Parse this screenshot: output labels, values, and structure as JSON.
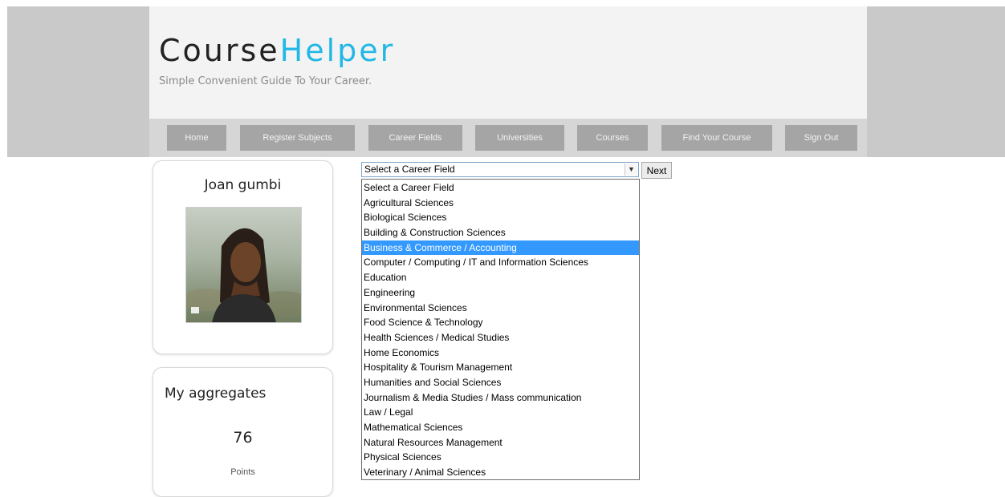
{
  "header": {
    "logo_part1": "Course",
    "logo_part2": "Helper",
    "tagline": "Simple Convenient Guide To Your Career."
  },
  "nav": {
    "items": [
      "Home",
      "Register Subjects",
      "Career Fields",
      "Universities",
      "Courses",
      "Find Your Course",
      "Sign Out"
    ]
  },
  "profile": {
    "name": "Joan gumbi"
  },
  "aggregates": {
    "title": "My aggregates",
    "value": "76",
    "unit": "Points"
  },
  "career_select": {
    "selected_label": "Select a Career Field",
    "next_label": "Next",
    "highlighted_option": "Business & Commerce / Accounting",
    "options": [
      "Select a Career Field",
      "Agricultural Sciences",
      "Biological Sciences",
      "Building & Construction Sciences",
      "Business & Commerce / Accounting",
      "Computer / Computing / IT and Information Sciences",
      "Education",
      "Engineering",
      "Environmental Sciences",
      "Food Science & Technology",
      "Health Sciences / Medical Studies",
      "Home Economics",
      "Hospitality & Tourism Management",
      "Humanities and Social Sciences",
      "Journalism & Media Studies / Mass communication",
      "Law / Legal",
      "Mathematical Sciences",
      "Natural Resources Management",
      "Physical Sciences",
      "Veterinary / Animal Sciences"
    ]
  },
  "colors": {
    "accent": "#22b8e6",
    "nav_button": "#a5a5a5",
    "selection": "#3399ff"
  }
}
